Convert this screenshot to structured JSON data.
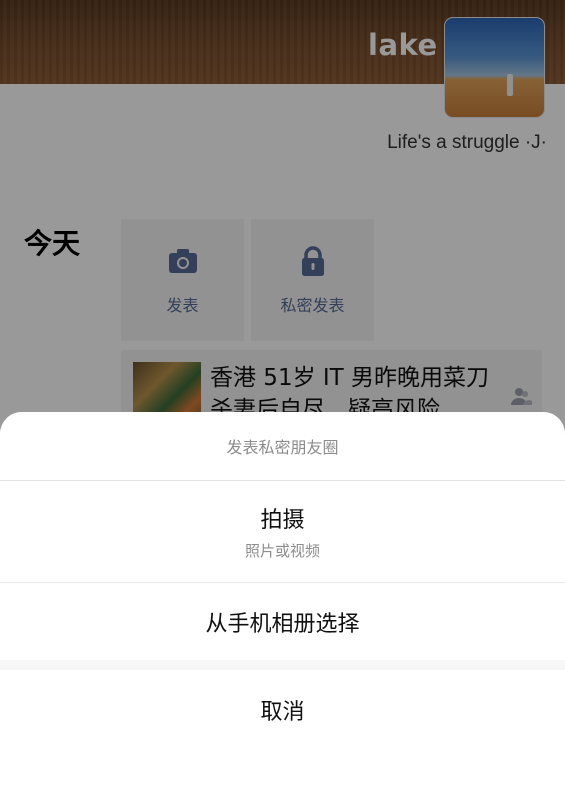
{
  "profile": {
    "username": "lake",
    "signature": "Life's a struggle ·J·"
  },
  "timeline": {
    "day_label": "今天",
    "post_buttons": [
      {
        "label": "发表",
        "icon": "camera-icon"
      },
      {
        "label": "私密发表",
        "icon": "lock-icon"
      }
    ],
    "feed_item": {
      "title": "香港 51岁 IT 男昨晚用菜刀杀妻后自尽，疑高风险",
      "visibility_icon": "group-icon"
    }
  },
  "action_sheet": {
    "title": "发表私密朋友圈",
    "options": [
      {
        "label": "拍摄",
        "sublabel": "照片或视频"
      },
      {
        "label": "从手机相册选择"
      }
    ],
    "cancel_label": "取消"
  },
  "colors": {
    "link_blue": "#576b95",
    "overlay": "rgba(0,0,0,0.40)",
    "sheet_background": "#f7f7f7"
  }
}
